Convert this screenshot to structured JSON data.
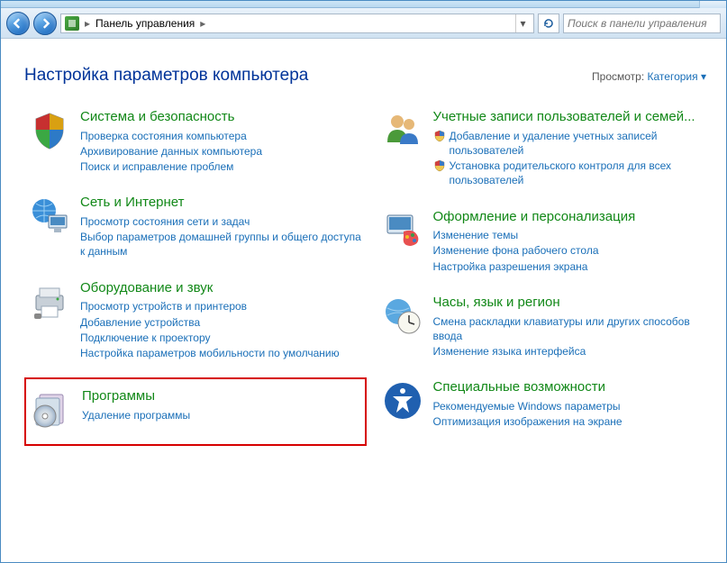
{
  "nav": {
    "breadcrumb_root": "Панель управления",
    "search_placeholder": "Поиск в панели управления"
  },
  "header": {
    "title": "Настройка параметров компьютера",
    "view_label": "Просмотр:",
    "view_value": "Категория"
  },
  "left": [
    {
      "title": "Система и безопасность",
      "links": [
        {
          "text": "Проверка состояния компьютера"
        },
        {
          "text": "Архивирование данных компьютера"
        },
        {
          "text": "Поиск и исправление проблем"
        }
      ]
    },
    {
      "title": "Сеть и Интернет",
      "links": [
        {
          "text": "Просмотр состояния сети и задач"
        },
        {
          "text": "Выбор параметров домашней группы и общего доступа к данным"
        }
      ]
    },
    {
      "title": "Оборудование и звук",
      "links": [
        {
          "text": "Просмотр устройств и принтеров"
        },
        {
          "text": "Добавление устройства"
        },
        {
          "text": "Подключение к проектору"
        },
        {
          "text": "Настройка параметров мобильности по умолчанию"
        }
      ]
    },
    {
      "title": "Программы",
      "highlighted": true,
      "links": [
        {
          "text": "Удаление программы"
        }
      ]
    }
  ],
  "right": [
    {
      "title": "Учетные записи пользователей и семей...",
      "links": [
        {
          "text": "Добавление и удаление учетных записей пользователей",
          "shield": true
        },
        {
          "text": "Установка родительского контроля для всех пользователей",
          "shield": true
        }
      ]
    },
    {
      "title": "Оформление и персонализация",
      "links": [
        {
          "text": "Изменение темы"
        },
        {
          "text": "Изменение фона рабочего стола"
        },
        {
          "text": "Настройка разрешения экрана"
        }
      ]
    },
    {
      "title": "Часы, язык и регион",
      "links": [
        {
          "text": "Смена раскладки клавиатуры или других способов ввода"
        },
        {
          "text": "Изменение языка интерфейса"
        }
      ]
    },
    {
      "title": "Специальные возможности",
      "links": [
        {
          "text": "Рекомендуемые Windows параметры"
        },
        {
          "text": "Оптимизация изображения на экране"
        }
      ]
    }
  ]
}
